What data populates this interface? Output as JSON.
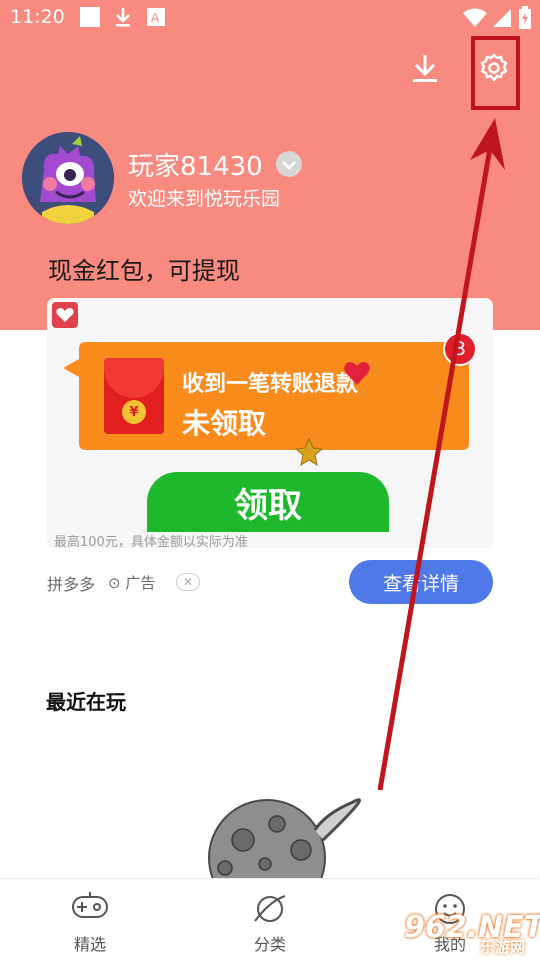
{
  "status_bar": {
    "time": "11:20",
    "icons": [
      "notification-square-icon",
      "download-icon",
      "a-badge-icon",
      "wifi-icon",
      "signal-icon",
      "battery-icon"
    ]
  },
  "colors": {
    "header_bg": "#f98a80",
    "bubble_bg": "#f98a1c",
    "claim_green": "#1eb82c",
    "detail_blue": "#4f78e8",
    "annotation_red": "#c0151b"
  },
  "header": {
    "download_icon": "download-icon",
    "settings_icon": "settings-gear-icon",
    "username": "玩家81430",
    "welcome": "欢迎来到悦玩乐园",
    "promo_title": "现金红包，可提现"
  },
  "ad": {
    "bubble_line1": "收到一笔转账退款",
    "bubble_line2": "未领取",
    "coin_symbol": "¥",
    "counter": "3",
    "claim_label": "领取",
    "disclaimer": "最高100元，具体金额以实际为准",
    "source": "拼多多",
    "tag": "广告",
    "close_symbol": "✕",
    "detail_label": "查看详情"
  },
  "recent": {
    "title": "最近在玩"
  },
  "bottom_nav": {
    "items": [
      {
        "label": "精选",
        "icon": "gamepad-icon"
      },
      {
        "label": "分类",
        "icon": "planet-icon"
      },
      {
        "label": "我的",
        "icon": "smiley-icon"
      }
    ]
  },
  "watermark": {
    "main": "962.NET",
    "sub": "乐游网"
  }
}
